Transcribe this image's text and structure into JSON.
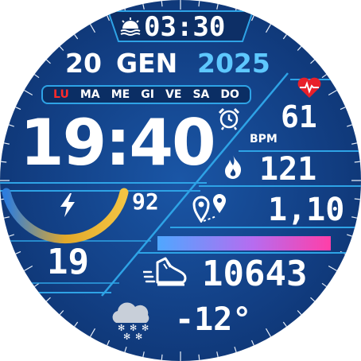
{
  "top_time": "03:30",
  "date": {
    "day": "20",
    "month": "GEN",
    "year": "2025"
  },
  "weekdays": [
    {
      "label": "LU",
      "active": true
    },
    {
      "label": "MA",
      "active": false
    },
    {
      "label": "ME",
      "active": false
    },
    {
      "label": "GI",
      "active": false
    },
    {
      "label": "VE",
      "active": false
    },
    {
      "label": "SA",
      "active": false
    },
    {
      "label": "DO",
      "active": false
    }
  ],
  "main_time": "19:40",
  "battery": {
    "value": "92",
    "level": 0.92
  },
  "day_number": "19",
  "heart_rate": {
    "value": "61",
    "unit": "BPM"
  },
  "calories": "121",
  "distance": "1,10",
  "steps": "10643",
  "weather": {
    "temperature": "-12°",
    "condition_icon": "snow-cloud-icon"
  },
  "colors": {
    "accent": "#5ec8ff",
    "active_day": "#ff2a2a",
    "heart": "#e8202a",
    "background": "#123f84"
  },
  "icons": {
    "alarm": "alarm-clock-icon",
    "flame": "flame-icon",
    "distance": "map-pins-icon",
    "steps": "running-shoe-icon",
    "sunrise": "sunrise-icon",
    "heart": "heart-pulse-icon",
    "battery": "lightning-icon"
  },
  "steps_progress": 1.0
}
